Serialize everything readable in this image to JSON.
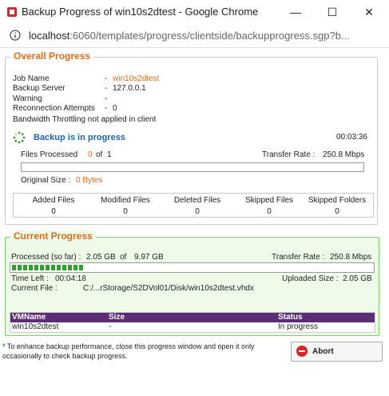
{
  "window": {
    "title": "Backup Progress of win10s2dtest - Google Chrome",
    "minimize": "—",
    "maximize": "☐",
    "close": "✕"
  },
  "address": {
    "host": "localhost",
    "path": ":6060/templates/progress/clientside/backupprogress.sgp?b..."
  },
  "overall": {
    "legend": "Overall Progress",
    "job_label": "Job Name",
    "job_value": "win10s2dtest",
    "server_label": "Backup Server",
    "server_value": "127.0.0.1",
    "warning_label": "Warning",
    "warning_value": "",
    "reconnect_label": "Reconnection Attempts",
    "reconnect_value": "0",
    "dash": "-",
    "throttle": "Bandwidth Throttling not applied in client",
    "status": "Backup is in progress",
    "elapsed": "00:03:36",
    "files_processed_label": "Files Processed",
    "files_processed": "0",
    "files_of": "of",
    "files_total": "1",
    "transfer_label": "Transfer Rate :",
    "transfer_value": "250.8 Mbps",
    "files_progress_fraction": 0,
    "original_size_label": "Original Size :",
    "original_size_value": "0 Bytes",
    "stats_headers": [
      "Added Files",
      "Modified Files",
      "Deleted Files",
      "Skipped Files",
      "Skipped Folders"
    ],
    "stats_values": [
      "0",
      "0",
      "0",
      "0",
      "0"
    ]
  },
  "current": {
    "legend": "Current Progress",
    "processed_label": "Processed (so far) :",
    "processed_value": "2.05 GB",
    "processed_of": "of",
    "processed_total": "9.97 GB",
    "transfer_label": "Transfer Rate :",
    "transfer_value": "250.8 Mbps",
    "progress_fraction": 0.21,
    "time_left_label": "Time Left :",
    "time_left_value": "00:04:18",
    "uploaded_label": "Uploaded Size :",
    "uploaded_value": "2.05 GB",
    "current_file_label": "Current File :",
    "current_file_value": "C:/...rStorage/S2DVol01/Disk/win10s2dtest.vhdx"
  },
  "vm_table": {
    "headers": [
      "VMName",
      "Size",
      "Status"
    ],
    "rows": [
      [
        "win10s2dtest",
        "-",
        "In progress"
      ]
    ]
  },
  "footer": {
    "note_star": "*",
    "note": "To enhance backup performance, close this progress window and open it only occasionally to check backup progress.",
    "abort_label": "Abort"
  },
  "colors": {
    "accent": "#e06a1b",
    "status_blue": "#1b64b5",
    "progress_green": "#2fa12c",
    "table_header": "#5b2d76",
    "panel_green": "#eefbe8"
  }
}
